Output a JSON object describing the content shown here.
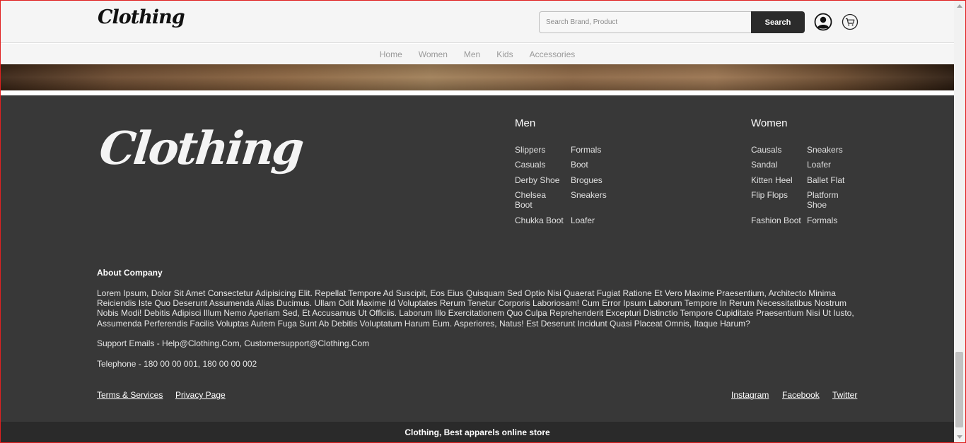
{
  "header": {
    "logo_text": "Clothing",
    "search_placeholder": "Search Brand, Product",
    "search_button": "Search",
    "icons": [
      "user-icon",
      "cart-icon"
    ]
  },
  "nav": {
    "items": [
      "Home",
      "Women",
      "Men",
      "Kids",
      "Accessories"
    ]
  },
  "footer": {
    "logo_text": "Clothing",
    "men": {
      "title": "Men",
      "col1": [
        "Slippers",
        "Casuals",
        "Derby Shoe",
        "Chelsea Boot",
        "Chukka Boot"
      ],
      "col2": [
        "Formals",
        "Boot",
        "Brogues",
        "Sneakers",
        "Loafer"
      ]
    },
    "women": {
      "title": "Women",
      "col1": [
        "Causals",
        "Sandal",
        "Kitten Heel",
        "Flip Flops",
        "Fashion Boot"
      ],
      "col2": [
        "Sneakers",
        "Loafer",
        "Ballet Flat",
        "Platform Shoe",
        "Formals"
      ]
    },
    "about": {
      "title": "About Company",
      "text": "Lorem Ipsum, Dolor Sit Amet Consectetur Adipisicing Elit. Repellat Tempore Ad Suscipit, Eos Eius Quisquam Sed Optio Nisi Quaerat Fugiat Ratione Et Vero Maxime Praesentium, Architecto Minima Reiciendis Iste Quo Deserunt Assumenda Alias Ducimus. Ullam Odit Maxime Id Voluptates Rerum Tenetur Corporis Laboriosam! Cum Error Ipsum Laborum Tempore In Rerum Necessitatibus Nostrum Nobis Modi! Debitis Adipisci Illum Nemo Aperiam Sed, Et Accusamus Ut Officiis. Laborum Illo Exercitationem Quo Culpa Reprehenderit Excepturi Distinctio Tempore Cupiditate Praesentium Nisi Ut Iusto, Assumenda Perferendis Facilis Voluptas Autem Fuga Sunt Ab Debitis Voluptatum Harum Eum. Asperiores, Natus! Est Deserunt Incidunt Quasi Placeat Omnis, Itaque Harum?",
      "support": "Support Emails - Help@Clothing.Com, Customersupport@Clothing.Com",
      "telephone": "Telephone - 180 00 00 001, 180 00 00 002"
    },
    "links_left": [
      "Terms & Services",
      "Privacy Page"
    ],
    "links_right": [
      "Instagram",
      "Facebook",
      "Twitter"
    ]
  },
  "bottom_bar": "Clothing, Best apparels online store",
  "colors": {
    "footer_bg": "#383838",
    "bottom_bar_bg": "#2a2a2a",
    "header_bg": "#f5f5f5",
    "search_button_bg": "#2b2b2b"
  }
}
